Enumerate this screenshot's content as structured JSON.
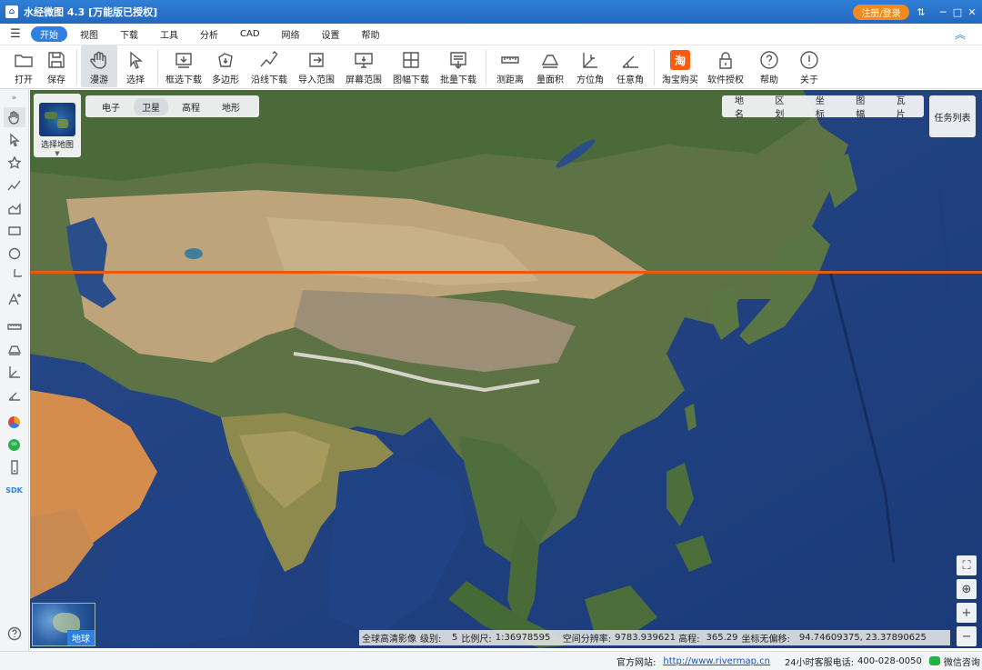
{
  "titlebar": {
    "title": "水经微图 4.3 [万能版已授权]",
    "login": "注册/登录",
    "minimize": "─",
    "maximize": "□",
    "close": "✕",
    "pin": "⇅"
  },
  "menu": {
    "items": [
      "开始",
      "视图",
      "下载",
      "工具",
      "分析",
      "CAD",
      "网络",
      "设置",
      "帮助"
    ],
    "active_index": 0
  },
  "toolbar": {
    "open": "打开",
    "save": "保存",
    "pan": "漫游",
    "select": "选择",
    "rect_download": "框选下载",
    "polygon": "多边形",
    "line_download": "沿线下载",
    "import_range": "导入范围",
    "screen_range": "屏幕范围",
    "sheet_download": "图幅下载",
    "batch_download": "批量下载",
    "measure_distance": "测距离",
    "measure_area": "量面积",
    "azimuth": "方位角",
    "any_angle": "任意角",
    "taobao": "淘宝购买",
    "license": "软件授权",
    "help": "帮助",
    "about": "关于",
    "taobao_char": "淘"
  },
  "sidebar": {
    "sdk": "SDK"
  },
  "map": {
    "layers": [
      "电子",
      "卫星",
      "高程",
      "地形"
    ],
    "active_layer_index": 1,
    "overlays": [
      "地名",
      "区划",
      "坐标",
      "图幅",
      "瓦片"
    ],
    "select_map": "选择地图",
    "task_list": "任务列表",
    "globe_label": "地球",
    "status": {
      "source": "全球高清影像",
      "level_label": "级别:",
      "level": "5",
      "scale_label": "比例尺:",
      "scale": "1:36978595",
      "resolution_label": "空间分辨率:",
      "resolution": "9783.939621",
      "elevation_label": "高程:",
      "elevation": "365.29",
      "coord_label": "坐标无偏移:",
      "coord": "94.74609375, 23.37890625"
    }
  },
  "footer": {
    "site_label": "官方网站:",
    "site": "http://www.rivermap.cn",
    "phone_label": "24小时客服电话:",
    "phone": "400-028-0050",
    "wechat": "微信咨询"
  }
}
